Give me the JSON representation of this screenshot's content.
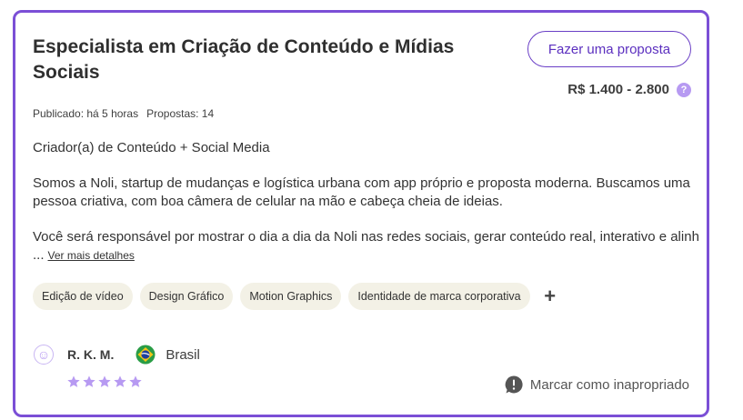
{
  "project": {
    "title": "Especialista em Criação de Conteúdo e Mídias Sociais",
    "proposal_button": "Fazer uma proposta",
    "price": "R$ 1.400 - 2.800",
    "help_icon": "?",
    "published": "Publicado: há 5 horas",
    "proposals": "Propostas: 14",
    "subtitle": "Criador(a) de Conteúdo + Social Media",
    "description_1": "Somos a Noli, startup de mudanças e logística urbana com app próprio e proposta moderna. Buscamos uma pessoa criativa, com boa câmera de celular na mão e cabeça cheia de ideias.",
    "description_2": "Você será responsável por mostrar o dia a dia da Noli nas redes sociais, gerar conteúdo real, interativo e alinh ...",
    "more_link": "Ver mais detalhes",
    "tags": [
      "Edição de vídeo",
      "Design Gráfico",
      "Motion Graphics",
      "Identidade de marca corporativa"
    ],
    "more_tags_icon": "+"
  },
  "client": {
    "name": "R. K. M.",
    "country": "Brasil",
    "flag_icon": "brazil-flag-icon",
    "rating": 5,
    "rating_max": 5
  },
  "report": {
    "label": "Marcar como inapropriado",
    "icon": "alert-bubble-icon"
  },
  "colors": {
    "accent": "#7b4fd6",
    "button_text": "#5b2fbf",
    "star": "#b79af2",
    "tag_bg": "#f3f1e6"
  }
}
